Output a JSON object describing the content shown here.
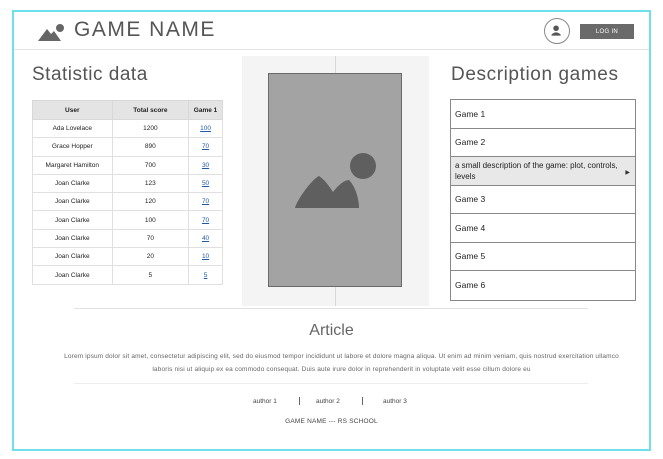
{
  "header": {
    "title": "GAME NAME",
    "login_label": "LOG IN",
    "logo_icon": "mountain-sun-icon",
    "user_icon": "user-icon"
  },
  "stats": {
    "title": "Statistic data",
    "columns": [
      "User",
      "Total score",
      "Game 1"
    ],
    "rows": [
      [
        "Ada Lovelace",
        "1200",
        "100"
      ],
      [
        "Grace Hopper",
        "890",
        "70"
      ],
      [
        "Margaret Hamilton",
        "700",
        "30"
      ],
      [
        "Joan Clarke",
        "123",
        "50"
      ],
      [
        "Joan Clarke",
        "120",
        "70"
      ],
      [
        "Joan Clarke",
        "100",
        "70"
      ],
      [
        "Joan Clarke",
        "70",
        "40"
      ],
      [
        "Joan Clarke",
        "20",
        "10"
      ],
      [
        "Joan Clarke",
        "5",
        "5"
      ]
    ]
  },
  "media": {
    "icon": "image-placeholder-icon"
  },
  "description": {
    "title": "Description games",
    "items": [
      {
        "label": "Game 1"
      },
      {
        "label": "Game 2"
      },
      {
        "label": "a small description of the game: plot, controls, levels",
        "expanded": true
      },
      {
        "label": "Game 3"
      },
      {
        "label": "Game 4"
      },
      {
        "label": "Game 5"
      },
      {
        "label": "Game 6"
      }
    ]
  },
  "article": {
    "title": "Article",
    "text": "Lorem ipsum dolor sit amet, consectetur adipiscing elit, sed do eiusmod tempor incididunt ut labore et dolore magna aliqua. Ut enim ad minim veniam, quis nostrud exercitation ullamco laboris nisi ut aliquip ex ea commodo consequat. Duis aute irure dolor in reprehenderit in voluptate velit esse cillum dolore eu"
  },
  "authors": [
    "author 1",
    "author 2",
    "author 3"
  ],
  "footer": {
    "text": "GAME NAME --- RS SCHOOL"
  },
  "colors": {
    "frame": "#6ee0ea",
    "image_fill": "#a3a3a3",
    "button": "#6a6a6a",
    "link": "#1e5aa8"
  }
}
